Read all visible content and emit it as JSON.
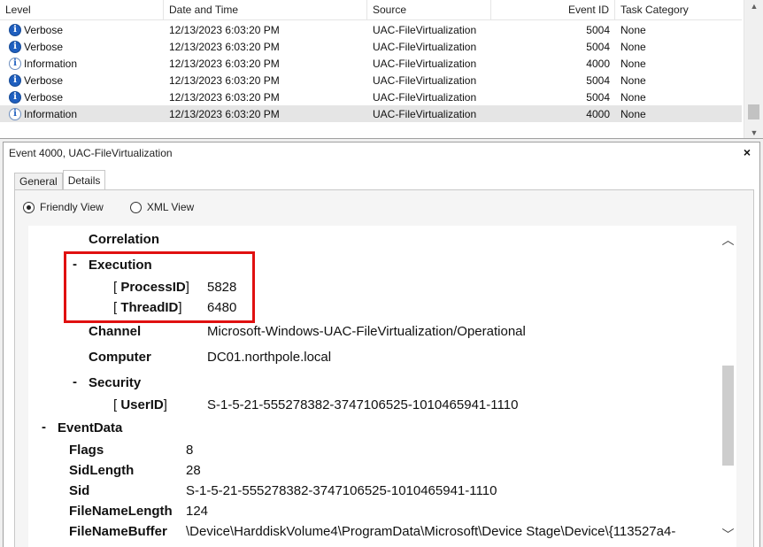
{
  "event_list": {
    "columns": {
      "level": "Level",
      "date_time": "Date and Time",
      "source": "Source",
      "event_id": "Event ID",
      "task_category": "Task Category"
    },
    "rows": [
      {
        "level": "Verbose",
        "icon": "verbose-icon",
        "date": "12/13/2023 6:03:20 PM",
        "source": "UAC-FileVirtualization",
        "event_id": "5004",
        "category": "None"
      },
      {
        "level": "Verbose",
        "icon": "verbose-icon",
        "date": "12/13/2023 6:03:20 PM",
        "source": "UAC-FileVirtualization",
        "event_id": "5004",
        "category": "None"
      },
      {
        "level": "Information",
        "icon": "information-icon",
        "date": "12/13/2023 6:03:20 PM",
        "source": "UAC-FileVirtualization",
        "event_id": "4000",
        "category": "None"
      },
      {
        "level": "Verbose",
        "icon": "verbose-icon",
        "date": "12/13/2023 6:03:20 PM",
        "source": "UAC-FileVirtualization",
        "event_id": "5004",
        "category": "None"
      },
      {
        "level": "Verbose",
        "icon": "verbose-icon",
        "date": "12/13/2023 6:03:20 PM",
        "source": "UAC-FileVirtualization",
        "event_id": "5004",
        "category": "None"
      },
      {
        "level": "Information",
        "icon": "information-icon",
        "date": "12/13/2023 6:03:20 PM",
        "source": "UAC-FileVirtualization",
        "event_id": "4000",
        "category": "None"
      }
    ]
  },
  "detail": {
    "title": "Event 4000, UAC-FileVirtualization",
    "close_symbol": "×",
    "tabs": [
      "General",
      "Details"
    ],
    "active_tab": "Details",
    "view_options": [
      "Friendly View",
      "XML View"
    ],
    "selected_view": "Friendly View",
    "tree": {
      "correlation": "Correlation",
      "dash": "-",
      "execution": "Execution",
      "lb": "[",
      "rb": "]",
      "process_id_label": "ProcessID",
      "process_id_value": "5828",
      "thread_id_label": "ThreadID",
      "thread_id_value": "6480",
      "channel_label": "Channel",
      "channel_value": "Microsoft-Windows-UAC-FileVirtualization/Operational",
      "computer_label": "Computer",
      "computer_value": "DC01.northpole.local",
      "security": "Security",
      "user_id_label": "UserID",
      "user_id_value": "S-1-5-21-555278382-3747106525-1010465941-1110",
      "event_data": "EventData",
      "flags_label": "Flags",
      "flags_value": "8",
      "sid_length_label": "SidLength",
      "sid_length_value": "28",
      "sid_label": "Sid",
      "sid_value": "S-1-5-21-555278382-3747106525-1010465941-1110",
      "file_name_length_label": "FileNameLength",
      "file_name_length_value": "124",
      "file_name_buffer_label": "FileNameBuffer",
      "file_name_buffer_value": "\\Device\\HarddiskVolume4\\ProgramData\\Microsoft\\Device Stage\\Device\\{113527a4-"
    }
  },
  "colors": {
    "highlight_box": "#e01010",
    "verbose_icon": "#1f5fbf",
    "selected_row": "#e5e5e5"
  }
}
